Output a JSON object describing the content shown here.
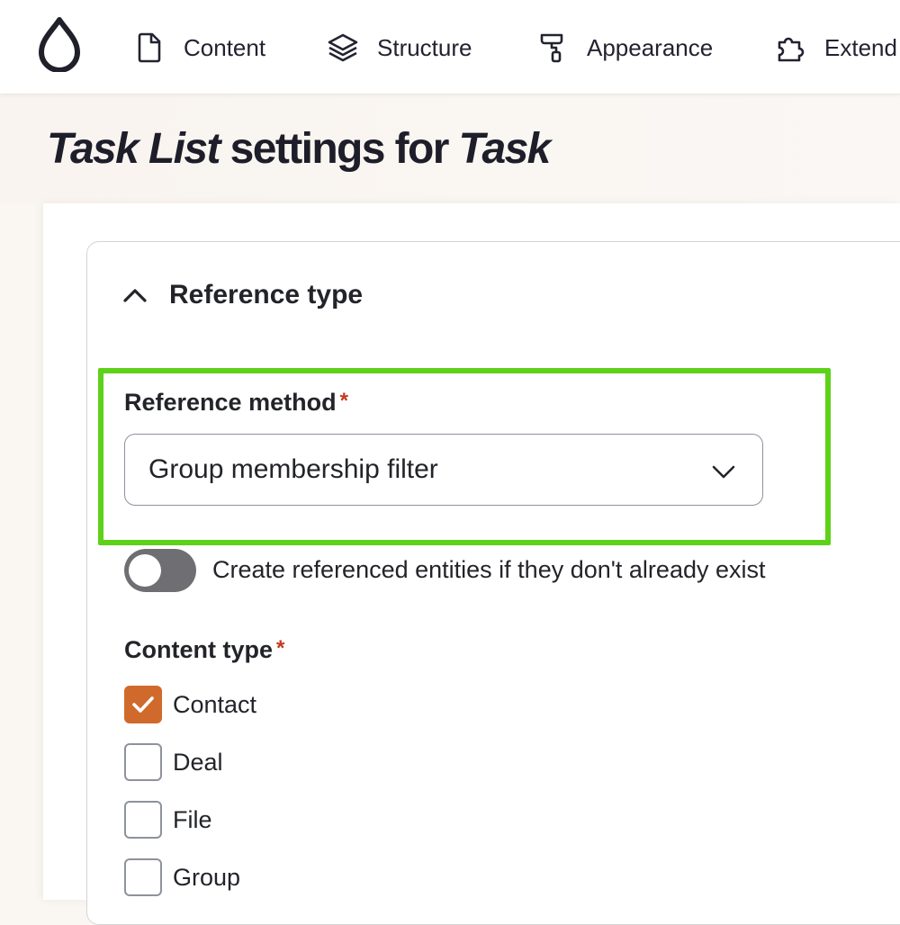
{
  "toolbar": {
    "logo_icon": "drupal-drop-icon",
    "items": [
      {
        "label": "Content",
        "icon": "document-icon"
      },
      {
        "label": "Structure",
        "icon": "layers-icon"
      },
      {
        "label": "Appearance",
        "icon": "paint-roller-icon"
      },
      {
        "label": "Extend",
        "icon": "puzzle-icon"
      }
    ]
  },
  "page": {
    "title_part1": "Task List",
    "title_part2": " settings for ",
    "title_part3": "Task"
  },
  "reference_type": {
    "summary": "Reference type",
    "icon": "chevron-up-icon",
    "reference_method": {
      "label": "Reference method",
      "required_mark": "*",
      "selected": "Group membership filter",
      "icon": "chevron-down-icon"
    },
    "auto_create": {
      "label": "Create referenced entities if they don't already exist",
      "enabled": false
    },
    "content_type": {
      "label": "Content type",
      "required_mark": "*",
      "options": [
        {
          "label": "Contact",
          "checked": true
        },
        {
          "label": "Deal",
          "checked": false
        },
        {
          "label": "File",
          "checked": false
        },
        {
          "label": "Group",
          "checked": false
        }
      ]
    }
  },
  "colors": {
    "highlight": "#5ed119",
    "checkbox_checked": "#cf6a2c",
    "required": "#c2391f"
  }
}
